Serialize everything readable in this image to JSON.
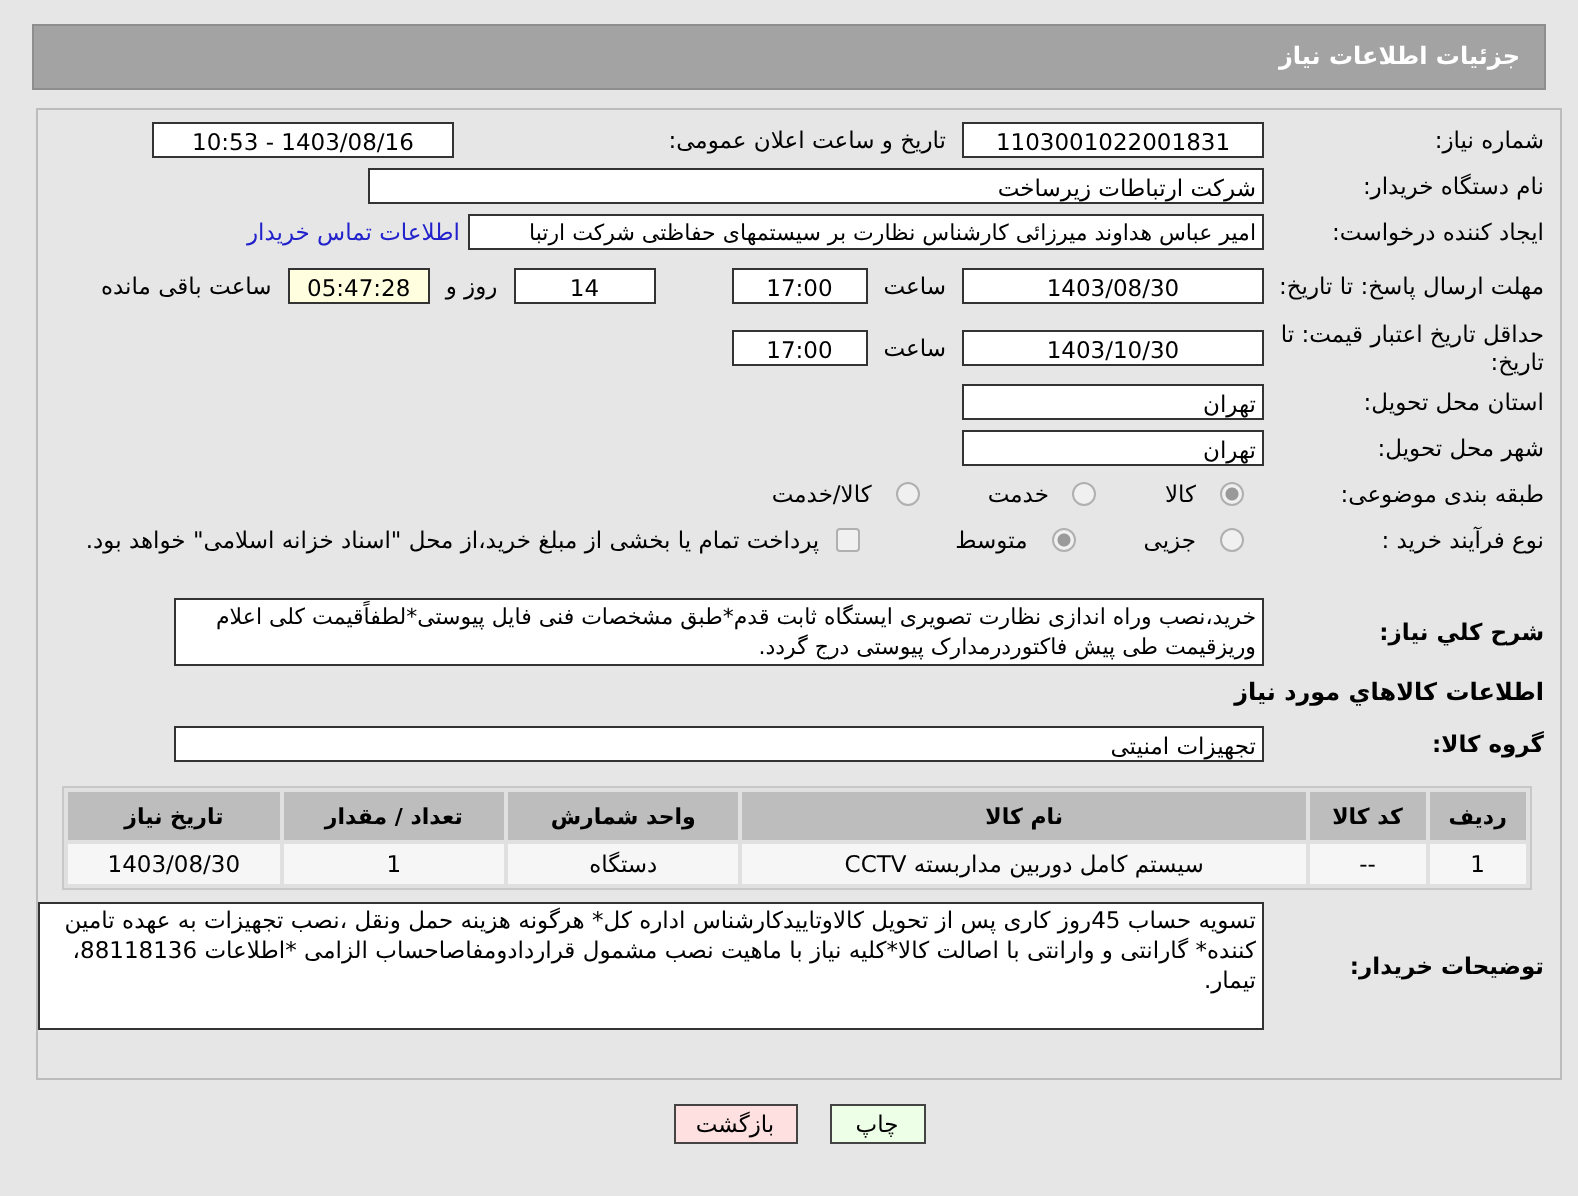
{
  "header": {
    "title": "جزئیات اطلاعات نیاز"
  },
  "need_number": {
    "label": "شماره نیاز:",
    "value": "1103001022001831"
  },
  "announce": {
    "label": "تاریخ و ساعت اعلان عمومی:",
    "value": "1403/08/16 - 10:53"
  },
  "buyer": {
    "label": "نام دستگاه خریدار:",
    "value": "شرکت ارتباطات زیرساخت"
  },
  "requester": {
    "label": "ایجاد کننده درخواست:",
    "value": "امیر عباس هداوند میرزائی کارشناس نظارت بر سیستمهای حفاظتی شرکت ارتبا",
    "link": "اطلاعات تماس خریدار"
  },
  "deadline": {
    "label": "مهلت ارسال پاسخ: تا تاریخ:",
    "date": "1403/08/30",
    "time_label": "ساعت",
    "time": "17:00",
    "days": "14",
    "days_label": "روز و",
    "remaining": "05:47:28",
    "remaining_label": "ساعت باقی مانده"
  },
  "validity": {
    "label": "حداقل تاریخ اعتبار قیمت: تا تاریخ:",
    "date": "1403/10/30",
    "time_label": "ساعت",
    "time": "17:00"
  },
  "province": {
    "label": "استان محل تحویل:",
    "value": "تهران"
  },
  "city": {
    "label": "شهر محل تحویل:",
    "value": "تهران"
  },
  "category": {
    "label": "طبقه بندی موضوعی:",
    "options": [
      {
        "label": "کالا",
        "selected": true
      },
      {
        "label": "خدمت",
        "selected": false
      },
      {
        "label": "کالا/خدمت",
        "selected": false
      }
    ]
  },
  "process": {
    "label": "نوع فرآیند خرید :",
    "options": [
      {
        "label": "جزیی",
        "selected": false
      },
      {
        "label": "متوسط",
        "selected": true
      }
    ],
    "treasury": {
      "checked": false,
      "text": "پرداخت تمام یا بخشی از مبلغ خرید،از محل \"اسناد خزانه اسلامی\" خواهد بود."
    }
  },
  "description": {
    "label": "شرح کلي نياز:",
    "value": "خرید،نصب وراه اندازی نظارت تصویری ایستگاه ثابت قدم*طبق مشخصات فنی فایل پیوستی*لطفاًقیمت کلی اعلام وریزقیمت طی پیش فاکتوردرمدارک پیوستی درج گردد."
  },
  "goods_heading": "اطلاعات کالاهاي مورد نياز",
  "group": {
    "label": "گروه کالا:",
    "value": "تجهیزات امنیتی"
  },
  "table": {
    "columns": [
      "ردیف",
      "کد کالا",
      "نام کالا",
      "واحد شمارش",
      "تعداد / مقدار",
      "تاریخ نیاز"
    ],
    "rows": [
      [
        "1",
        "--",
        "سیستم کامل دوربین مداربسته CCTV",
        "دستگاه",
        "1",
        "1403/08/30"
      ]
    ]
  },
  "buyer_notes": {
    "label": "توضیحات خریدار:",
    "value": "تسویه حساب 45روز کاری پس از تحویل کالاوتاییدکارشناس اداره کل* هرگونه هزینه حمل ونقل ،نصب تجهیزات به عهده تامین کننده* گارانتی و وارانتی با اصالت کالا*کلیه نیاز با ماهیت نصب مشمول قراردادومفاصاحساب الزامی *اطلاعات  88118136، تیمار."
  },
  "buttons": [
    {
      "label": "چاپ",
      "kind": "print"
    },
    {
      "label": "بازگشت",
      "kind": "back"
    }
  ]
}
